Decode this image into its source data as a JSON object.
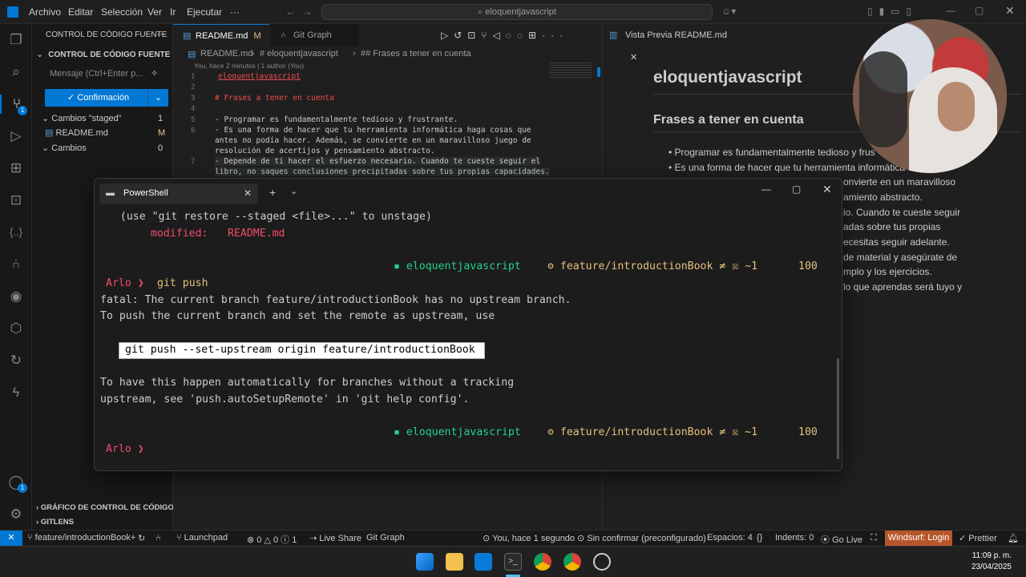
{
  "titlebar": {
    "menus": [
      "Archivo",
      "Editar",
      "Selección",
      "Ver",
      "Ir",
      "Ejecutar",
      "···"
    ],
    "search": "eloquentjavascript"
  },
  "sidebar": {
    "header": "CONTROL DE CÓDIGO FUENTE",
    "section": "CONTROL DE CÓDIGO FUENTE",
    "message_placeholder": "Mensaje (Ctrl+Enter p...",
    "commit_label": "Confirmación",
    "staged_label": "Cambios \"staged\"",
    "staged_count": "1",
    "staged_file": "README.md",
    "staged_file_status": "M",
    "changes_label": "Cambios",
    "changes_count": "0",
    "graph_label": "GRÁFICO DE CONTROL DE CÓDIGO...",
    "gitlens_label": "GITLENS"
  },
  "editor": {
    "tab_active": "README.md",
    "tab_active_status": "M",
    "tab_graph": "Git Graph",
    "breadcrumb": [
      "README.md",
      "# eloquentjavascript",
      "## Frases a tener en cuenta"
    ],
    "blame": "You, hace 2 minutos | 1 author (You)",
    "lines": [
      {
        "n": "1",
        "text": "eloquentjavascript"
      },
      {
        "n": "2",
        "text": ""
      },
      {
        "n": "3",
        "text": "# Frases a tener en cuenta"
      },
      {
        "n": "4",
        "text": ""
      },
      {
        "n": "5",
        "text": "- Programar es fundamentalmente tedioso y frustrante."
      },
      {
        "n": "6",
        "text": "- Es una forma de hacer que tu herramienta informática haga cosas que"
      },
      {
        "n": "",
        "text": "antes no podía hacer. Además, se convierte en un maravilloso juego de"
      },
      {
        "n": "",
        "text": "resolución de acertijos y pensamiento abstracto."
      },
      {
        "n": "7",
        "text": "- Depende de ti hacer el esfuerzo necesario. Cuando te cueste seguir el"
      },
      {
        "n": "",
        "text": "libro, no saques conclusiones precipitadas sobre tus propias capacidades."
      }
    ]
  },
  "preview": {
    "tab": "Vista Previa README.md",
    "title": "eloquentjavascript",
    "subtitle": "Frases a tener en cuenta",
    "bullets": [
      "Programar es fundamentalmente tedioso y frus",
      "Es una forma de hacer que tu herramienta informática"
    ],
    "fragments": [
      "onvierte en un maravilloso",
      "amiento abstracto.",
      "io. Cuando te cueste seguir",
      "adas sobre tus propias",
      "ecesitas seguir adelante.",
      "de material y asegúrate de",
      "mplo y los ejercicios.",
      "lo que aprendas será tuyo y"
    ]
  },
  "terminal": {
    "tab_label": "PowerShell",
    "lines": {
      "restore": "  (use \"git restore --staged <file>...\" to unstage)",
      "modified_label": "modified:",
      "modified_file": "README.md",
      "prompt_user": "Arlo",
      "prompt_symbol": "❯",
      "command": "git push",
      "fatal": "fatal: The current branch feature/introductionBook has no upstream branch.",
      "topush": "To push the current branch and set the remote as upstream, use",
      "suggestion": "git push --set-upstream origin feature/introductionBook",
      "auto1": "To have this happen automatically for branches without a tracking",
      "auto2": "upstream, see 'push.autoSetupRemote' in 'git help config'."
    },
    "status_repo": "eloquentjavascript",
    "status_branch": "feature/introductionBook ≠ ☒ ~1",
    "status_num": "100"
  },
  "statusbar": {
    "branch": "feature/introductionBook+",
    "launchpad": "Launchpad",
    "problems": "⊗ 0 △ 0 ⓘ 1",
    "liveshare": "Live Share",
    "gitgraph": "Git Graph",
    "blame": "You, hace 1 segundo",
    "unconfirmed": "Sin confirmar (preconfigurado)",
    "spaces": "Espacios: 4",
    "indents": "Indents: 0",
    "golive": "Go Live",
    "windsurf": "Windsurf: Login",
    "prettier": "Prettier"
  },
  "taskbar": {
    "time": "11:09 p. m.",
    "date": "23/04/2025"
  },
  "colors": {
    "accent": "#0078d4",
    "prompt": "#f14c6b",
    "green": "#23d18b",
    "yellow": "#e5c07b"
  }
}
